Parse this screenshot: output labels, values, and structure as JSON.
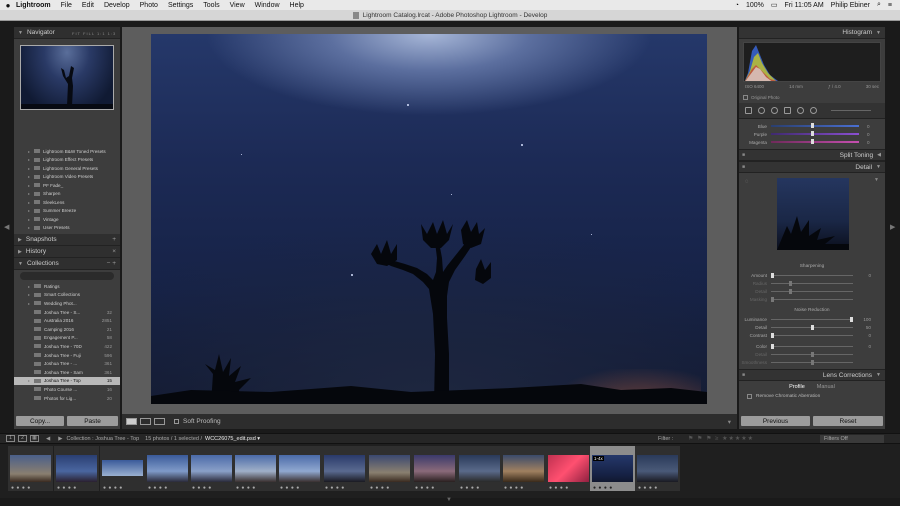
{
  "menubar": {
    "app_name": "Lightroom",
    "items": [
      "File",
      "Edit",
      "Develop",
      "Photo",
      "Settings",
      "Tools",
      "View",
      "Window",
      "Help"
    ],
    "battery": "100%",
    "clock": "Fri 11:05 AM",
    "user": "Philip Ebiner"
  },
  "window": {
    "title": "Lightroom Catalog.lrcat - Adobe Photoshop Lightroom - Develop"
  },
  "left_panel": {
    "navigator": {
      "title": "Navigator",
      "options": "FIT  FILL  1:1  1:3"
    },
    "presets": [
      "Lightroom B&W Toned Presets",
      "Lightroom Effect Presets",
      "Lightroom General Presets",
      "Lightroom Video Presets",
      "PF Fade_",
      "Sharpen",
      "SleekLens",
      "Summer Breeze",
      "Vintage",
      "User Presets"
    ],
    "snapshots": "Snapshots",
    "history": "History",
    "collections": {
      "title": "Collections",
      "items": [
        {
          "name": "Ratings",
          "count": ""
        },
        {
          "name": "Smart Collections",
          "count": ""
        },
        {
          "name": "Wedding Phot...",
          "count": ""
        },
        {
          "name": "Joshua Tree - S...",
          "count": "32"
        },
        {
          "name": "Australia 2016",
          "count": "2851"
        },
        {
          "name": "Camping 2016",
          "count": "21"
        },
        {
          "name": "Engagement P...",
          "count": "58"
        },
        {
          "name": "Joshua Tree - 70D",
          "count": "422"
        },
        {
          "name": "Joshua Tree - Fuji",
          "count": "596"
        },
        {
          "name": "Joshua Tree - ...",
          "count": "361"
        },
        {
          "name": "Joshua Tree - Sam",
          "count": "361"
        },
        {
          "name": "Joshua Tree - Top",
          "count": "15"
        },
        {
          "name": "Photo Course ...",
          "count": "16"
        },
        {
          "name": "Photos for Lig...",
          "count": "20"
        }
      ]
    },
    "copy_label": "Copy...",
    "paste_label": "Paste"
  },
  "toolbar": {
    "soft_proofing": "Soft Proofing"
  },
  "right_panel": {
    "histogram": {
      "title": "Histogram",
      "iso": "ISO 6400",
      "focal": "14 mm",
      "aperture": "ƒ / 4.0",
      "shutter": "30 sec",
      "original_photo": "Original Photo"
    },
    "hsl": [
      {
        "label": "Blue",
        "value": "0",
        "color": "#4a6fd1"
      },
      {
        "label": "Purple",
        "value": "0",
        "color": "#8a4fd1"
      },
      {
        "label": "Magenta",
        "value": "0",
        "color": "#c64fb0"
      }
    ],
    "split_toning": "Split Toning",
    "detail": {
      "title": "Detail",
      "sharpening_title": "Sharpening",
      "sharpening": [
        {
          "label": "Amount",
          "value": "0",
          "pos": 0.0,
          "dim": false
        },
        {
          "label": "Radius",
          "value": "",
          "pos": 0.22,
          "dim": true
        },
        {
          "label": "Detail",
          "value": "",
          "pos": 0.22,
          "dim": true
        },
        {
          "label": "Masking",
          "value": "",
          "pos": 0.0,
          "dim": true
        }
      ],
      "noise_title": "Noise Reduction",
      "noise": [
        {
          "label": "Luminance",
          "value": "100",
          "pos": 1.0,
          "dim": false
        },
        {
          "label": "Detail",
          "value": "50",
          "pos": 0.5,
          "dim": false
        },
        {
          "label": "Contrast",
          "value": "0",
          "pos": 0.0,
          "dim": false
        },
        {
          "label": "Color",
          "value": "0",
          "pos": 0.0,
          "dim": false
        },
        {
          "label": "Detail",
          "value": "",
          "pos": 0.5,
          "dim": true
        },
        {
          "label": "Smoothness",
          "value": "",
          "pos": 0.5,
          "dim": true
        }
      ]
    },
    "lens": {
      "title": "Lens Corrections",
      "tab_profile": "Profile",
      "tab_manual": "Manual",
      "remove_ca": "Remove Chromatic Aberration"
    },
    "previous_label": "Previous",
    "reset_label": "Reset"
  },
  "filmbar": {
    "page1": "1",
    "page2": "2",
    "source": "Collection : Joshua Tree - Top",
    "count": "15 photos / 1 selected /",
    "filename": "WCC26075_edit.psd ▾",
    "filter_label": "Filter :",
    "filters_off": "Filters Off"
  },
  "filmstrip": {
    "selected_badge": "1-4x"
  }
}
